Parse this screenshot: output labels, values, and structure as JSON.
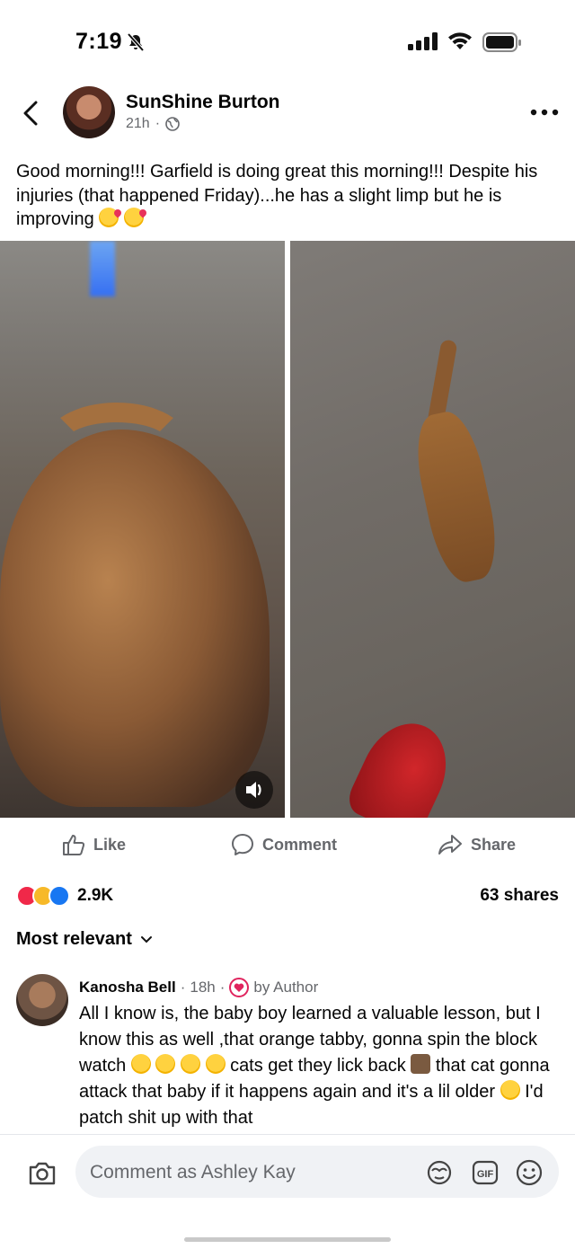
{
  "status_bar": {
    "time": "7:19"
  },
  "post": {
    "author": "SunShine Burton",
    "time": "21h",
    "visibility_icon": "globe-icon",
    "text": "Good morning!!! Garfield is doing great this morning!!! Despite his injuries (that happened Friday)...he has a slight limp but he is improving"
  },
  "actions": {
    "like": "Like",
    "comment": "Comment",
    "share": "Share"
  },
  "reactions": {
    "count": "2.9K",
    "shares": "63 shares"
  },
  "sort": {
    "label": "Most relevant"
  },
  "comment": {
    "name": "Kanosha Bell",
    "time": "18h",
    "badge": "by Author",
    "line1": "All I know is, the baby boy learned a valuable lesson, but I know this as well ,that orange tabby, gonna spin the block watch",
    "line2": "cats get they lick back",
    "line3": "that cat gonna attack that baby if it happens again and it's a lil older",
    "line4": "I'd patch shit up with that"
  },
  "composer": {
    "placeholder": "Comment as Ashley Kay"
  },
  "colors": {
    "like_blue": "#1877f2",
    "love_red": "#f02849",
    "muted": "#65676b"
  }
}
